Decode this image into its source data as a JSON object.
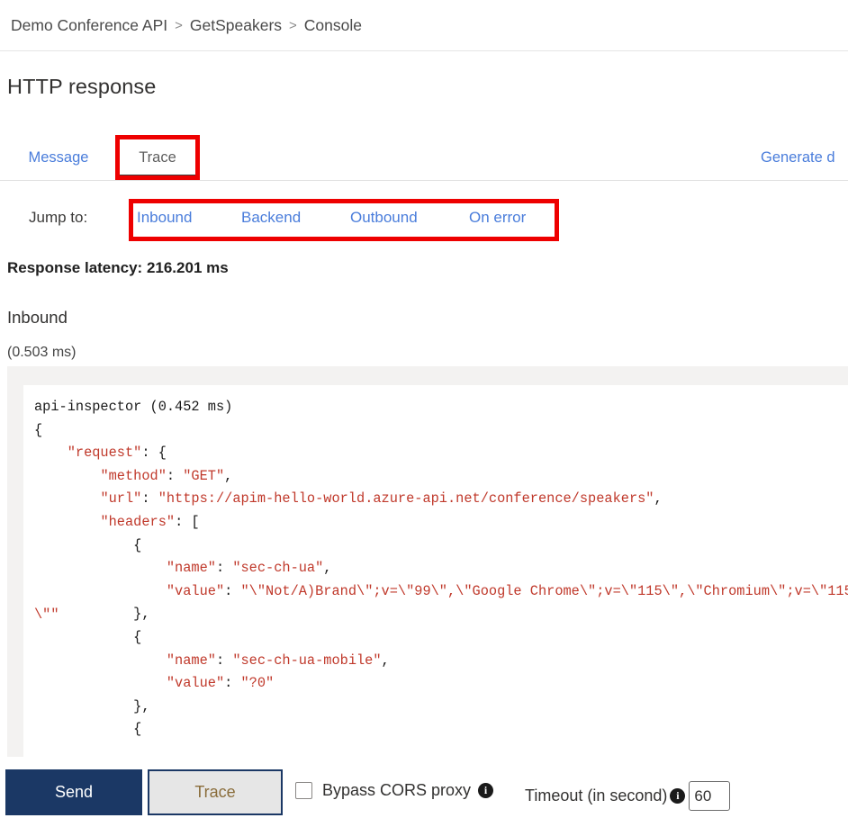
{
  "breadcrumb": {
    "items": [
      "Demo Conference API",
      "GetSpeakers",
      "Console"
    ],
    "separator": ">"
  },
  "page_title": "HTTP response",
  "tabs": {
    "message": "Message",
    "trace": "Trace",
    "generate_link": "Generate d",
    "active": "Trace"
  },
  "jump_to": {
    "label": "Jump to:",
    "links": [
      "Inbound",
      "Backend",
      "Outbound",
      "On error"
    ]
  },
  "latency": "Response latency: 216.201 ms",
  "inbound": {
    "title": "Inbound",
    "duration": "(0.503 ms)"
  },
  "code": {
    "header": "api-inspector (0.452 ms)",
    "wrapped_tail": "\\\"\"",
    "lines": [
      "{",
      "    \"request\": {",
      "        \"method\": \"GET\",",
      "        \"url\": \"https://apim-hello-world.azure-api.net/conference/speakers\",",
      "        \"headers\": [",
      "            {",
      "                \"name\": \"sec-ch-ua\",",
      "                \"value\": \"\\\"Not/A)Brand\\\";v=\\\"99\\\",\\\"Google Chrome\\\";v=\\\"115\\\",\\\"Chromium\\\";v=\\\"115\\\"\"",
      "            },",
      "            {",
      "                \"name\": \"sec-ch-ua-mobile\",",
      "                \"value\": \"?0\"",
      "            },",
      "            {"
    ]
  },
  "actions": {
    "send": "Send",
    "trace": "Trace",
    "bypass_cors_label": "Bypass CORS proxy",
    "bypass_cors_checked": false,
    "timeout_label": "Timeout (in second)",
    "timeout_value": "60",
    "info_glyph": "i"
  },
  "colors": {
    "link": "#4a7ddb",
    "annotation": "#ee0000",
    "primary_button": "#1b3865",
    "code_string": "#c0392b"
  }
}
